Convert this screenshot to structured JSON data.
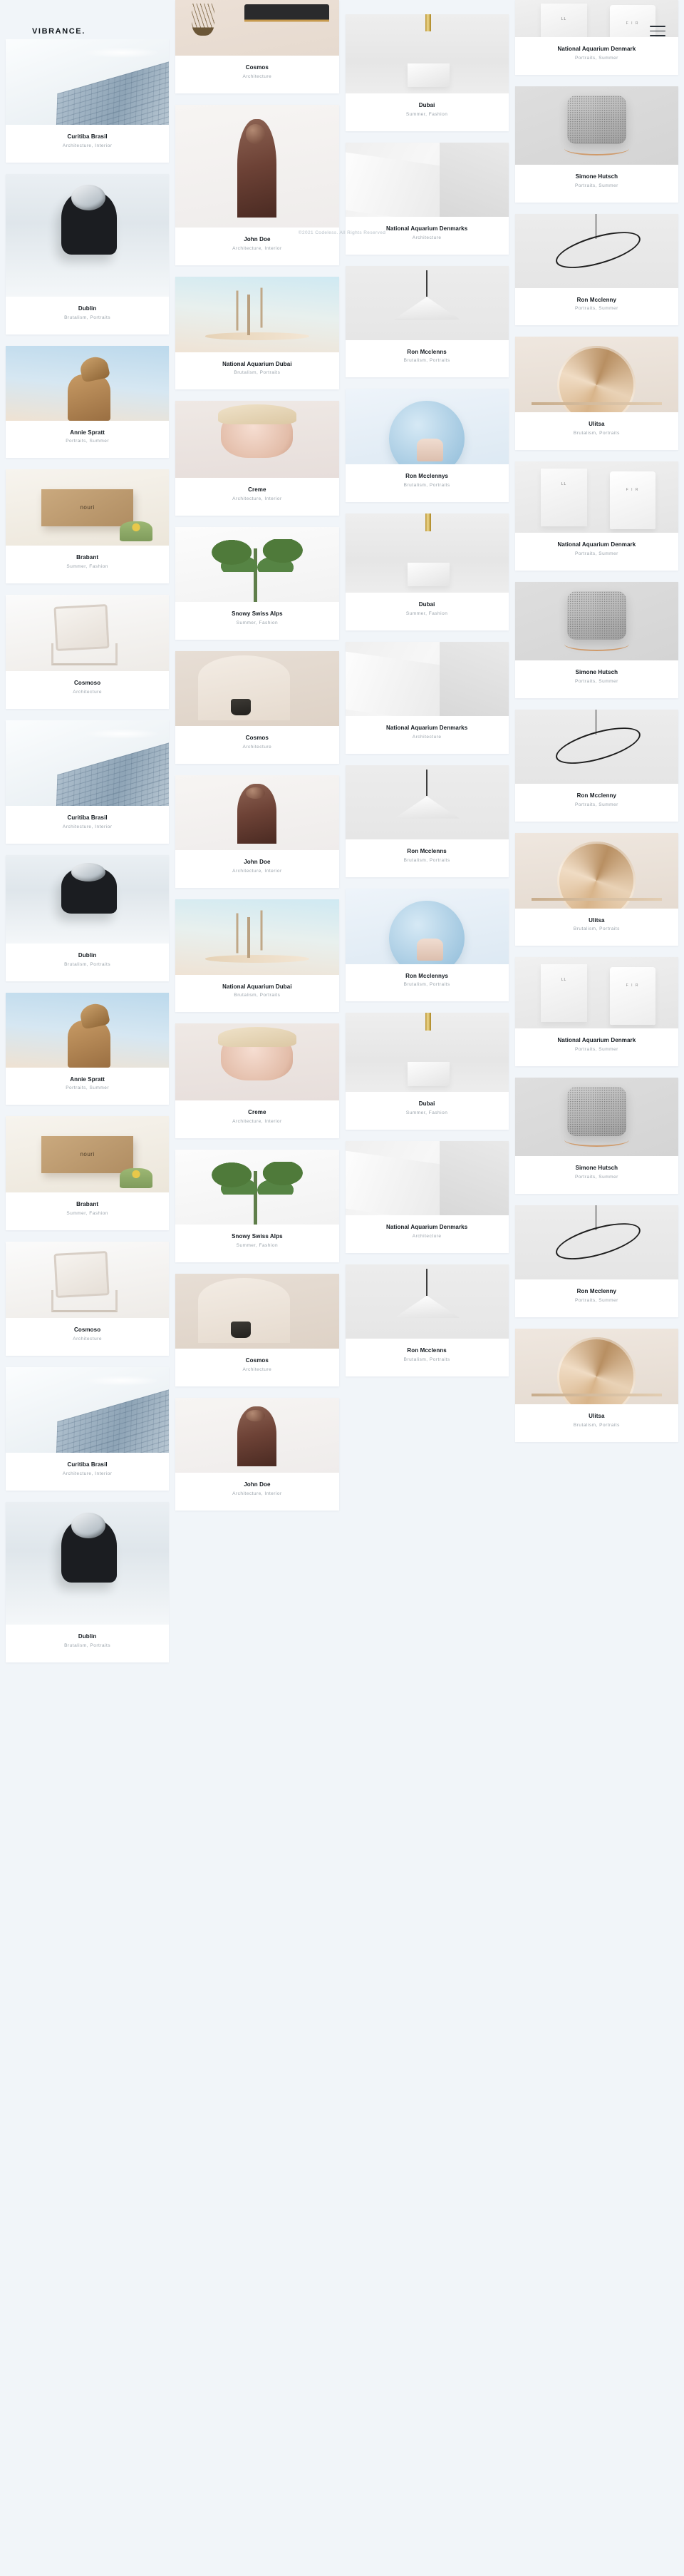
{
  "header": {
    "brand": "VIBRANCE.",
    "menu_icon": "hamburger-menu-icon"
  },
  "footer": {
    "copyright": "©2021 Codeless. All Rights Reserved"
  },
  "columns": [
    {
      "id": "column-1",
      "items": [
        {
          "title": "Curitiba Brasil",
          "subtitle": "Architecture, Interior",
          "art": "sc-tower",
          "h": 120
        },
        {
          "title": "Dublin",
          "subtitle": "Brutalism, Portraits",
          "art": "sc-astro",
          "h": 172
        },
        {
          "title": "Annie Spratt",
          "subtitle": "Portraits, Summer",
          "art": "sc-giraffe",
          "h": 105
        },
        {
          "title": "Brabant",
          "subtitle": "Summer, Fashion",
          "art": "sc-box",
          "h": 107
        },
        {
          "title": "Cosmoso",
          "subtitle": "Architecture",
          "art": "sc-chair",
          "h": 107
        },
        {
          "title": "Curitiba Brasil",
          "subtitle": "Architecture, Interior",
          "art": "sc-tower",
          "h": 120
        },
        {
          "title": "Dublin",
          "subtitle": "Brutalism, Portraits",
          "art": "sc-astro",
          "h": 124
        },
        {
          "title": "Annie Spratt",
          "subtitle": "Portraits, Summer",
          "art": "sc-giraffe",
          "h": 105
        },
        {
          "title": "Brabant",
          "subtitle": "Summer, Fashion",
          "art": "sc-box",
          "h": 107
        },
        {
          "title": "Cosmoso",
          "subtitle": "Architecture",
          "art": "sc-chair",
          "h": 107
        },
        {
          "title": "Curitiba Brasil",
          "subtitle": "Architecture, Interior",
          "art": "sc-tower",
          "h": 120
        },
        {
          "title": "Dublin",
          "subtitle": "Brutalism, Portraits",
          "art": "sc-astro",
          "h": 172
        }
      ]
    },
    {
      "id": "column-2",
      "items": [
        {
          "title": "Cosmos",
          "subtitle": "Architecture",
          "art": "sc-sofa",
          "h": 78
        },
        {
          "title": "John Doe",
          "subtitle": "Architecture, Interior",
          "art": "sc-statue",
          "h": 172
        },
        {
          "title": "National Aquarium Dubai",
          "subtitle": "Brutalism, Portraits",
          "art": "sc-branch",
          "h": 106
        },
        {
          "title": "Creme",
          "subtitle": "Architecture, Interior",
          "art": "sc-portrait",
          "h": 108
        },
        {
          "title": "Snowy Swiss Alps",
          "subtitle": "Summer, Fashion",
          "art": "sc-leaf",
          "h": 105
        },
        {
          "title": "Cosmos",
          "subtitle": "Architecture",
          "art": "sc-arch",
          "h": 105
        },
        {
          "title": "John Doe",
          "subtitle": "Architecture, Interior",
          "art": "sc-statue",
          "h": 105
        },
        {
          "title": "National Aquarium Dubai",
          "subtitle": "Brutalism, Portraits",
          "art": "sc-branch",
          "h": 106
        },
        {
          "title": "Creme",
          "subtitle": "Architecture, Interior",
          "art": "sc-portrait",
          "h": 108
        },
        {
          "title": "Snowy Swiss Alps",
          "subtitle": "Summer, Fashion",
          "art": "sc-leaf",
          "h": 105
        },
        {
          "title": "Cosmos",
          "subtitle": "Architecture",
          "art": "sc-arch",
          "h": 105
        },
        {
          "title": "John Doe",
          "subtitle": "Architecture, Interior",
          "art": "sc-statue",
          "h": 105
        }
      ]
    },
    {
      "id": "column-3",
      "items": [
        {
          "title": "Dubai",
          "subtitle": "Summer, Fashion",
          "art": "sc-brass",
          "h": 111
        },
        {
          "title": "National Aquarium Denmarks",
          "subtitle": "Architecture",
          "art": "sc-wall",
          "h": 104
        },
        {
          "title": "Ron Mcclenns",
          "subtitle": "Brutalism, Portraits",
          "art": "sc-cone",
          "h": 104
        },
        {
          "title": "Ron Mcclennys",
          "subtitle": "Brutalism, Portraits",
          "art": "sc-clock",
          "h": 106
        },
        {
          "title": "Dubai",
          "subtitle": "Summer, Fashion",
          "art": "sc-brass",
          "h": 111
        },
        {
          "title": "National Aquarium Denmarks",
          "subtitle": "Architecture",
          "art": "sc-wall",
          "h": 104
        },
        {
          "title": "Ron Mcclenns",
          "subtitle": "Brutalism, Portraits",
          "art": "sc-cone",
          "h": 104
        },
        {
          "title": "Ron Mcclennys",
          "subtitle": "Brutalism, Portraits",
          "art": "sc-clock",
          "h": 106
        },
        {
          "title": "Dubai",
          "subtitle": "Summer, Fashion",
          "art": "sc-brass",
          "h": 111
        },
        {
          "title": "National Aquarium Denmarks",
          "subtitle": "Architecture",
          "art": "sc-wall",
          "h": 104
        },
        {
          "title": "Ron Mcclenns",
          "subtitle": "Brutalism, Portraits",
          "art": "sc-cone",
          "h": 104
        }
      ]
    },
    {
      "id": "column-4",
      "items": [
        {
          "title": "National Aquarium Denmark",
          "subtitle": "Portraits, Summer",
          "art": "sc-bottles",
          "h": 52
        },
        {
          "title": "Simone Hutsch",
          "subtitle": "Portraits, Summer",
          "art": "sc-speaker",
          "h": 110
        },
        {
          "title": "Ron Mcclenny",
          "subtitle": "Portraits, Summer",
          "art": "sc-ring",
          "h": 104
        },
        {
          "title": "Ulitsa",
          "subtitle": "Brutalism, Portraits",
          "art": "sc-mirror",
          "h": 106
        },
        {
          "title": "National Aquarium Denmark",
          "subtitle": "Portraits, Summer",
          "art": "sc-bottles",
          "h": 100
        },
        {
          "title": "Simone Hutsch",
          "subtitle": "Portraits, Summer",
          "art": "sc-speaker",
          "h": 110
        },
        {
          "title": "Ron Mcclenny",
          "subtitle": "Portraits, Summer",
          "art": "sc-ring",
          "h": 104
        },
        {
          "title": "Ulitsa",
          "subtitle": "Brutalism, Portraits",
          "art": "sc-mirror",
          "h": 106
        },
        {
          "title": "National Aquarium Denmark",
          "subtitle": "Portraits, Summer",
          "art": "sc-bottles",
          "h": 100
        },
        {
          "title": "Simone Hutsch",
          "subtitle": "Portraits, Summer",
          "art": "sc-speaker",
          "h": 110
        },
        {
          "title": "Ron Mcclenny",
          "subtitle": "Portraits, Summer",
          "art": "sc-ring",
          "h": 104
        },
        {
          "title": "Ulitsa",
          "subtitle": "Brutalism, Portraits",
          "art": "sc-mirror",
          "h": 106
        }
      ]
    }
  ],
  "theme": {
    "page_bg": "#f1f5f9",
    "card_bg": "#ffffff",
    "title_color": "#12181e",
    "subtitle_color": "#9aa3ab"
  }
}
